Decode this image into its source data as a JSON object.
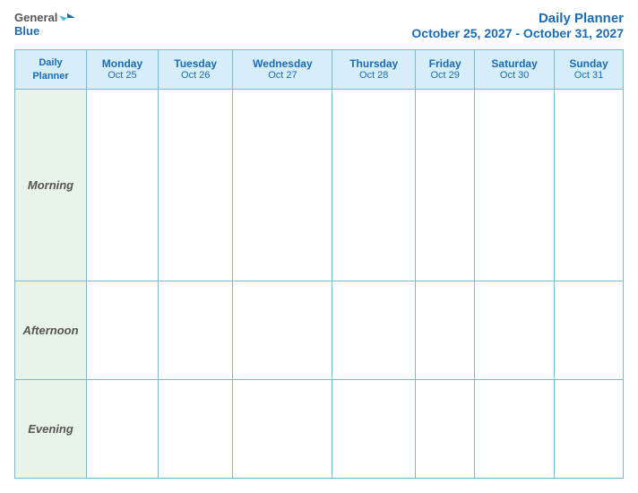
{
  "header": {
    "logo": {
      "general": "General",
      "blue": "Blue"
    },
    "title": "Daily Planner",
    "subtitle": "October 25, 2027 - October 31, 2027"
  },
  "table": {
    "columns": [
      {
        "day": "Daily\nPlanner",
        "date": "",
        "is_label": true
      },
      {
        "day": "Monday",
        "date": "Oct 25"
      },
      {
        "day": "Tuesday",
        "date": "Oct 26"
      },
      {
        "day": "Wednesday",
        "date": "Oct 27"
      },
      {
        "day": "Thursday",
        "date": "Oct 28"
      },
      {
        "day": "Friday",
        "date": "Oct 29"
      },
      {
        "day": "Saturday",
        "date": "Oct 30"
      },
      {
        "day": "Sunday",
        "date": "Oct 31"
      }
    ],
    "rows": [
      {
        "label": "Morning"
      },
      {
        "label": "Afternoon"
      },
      {
        "label": "Evening"
      }
    ]
  }
}
